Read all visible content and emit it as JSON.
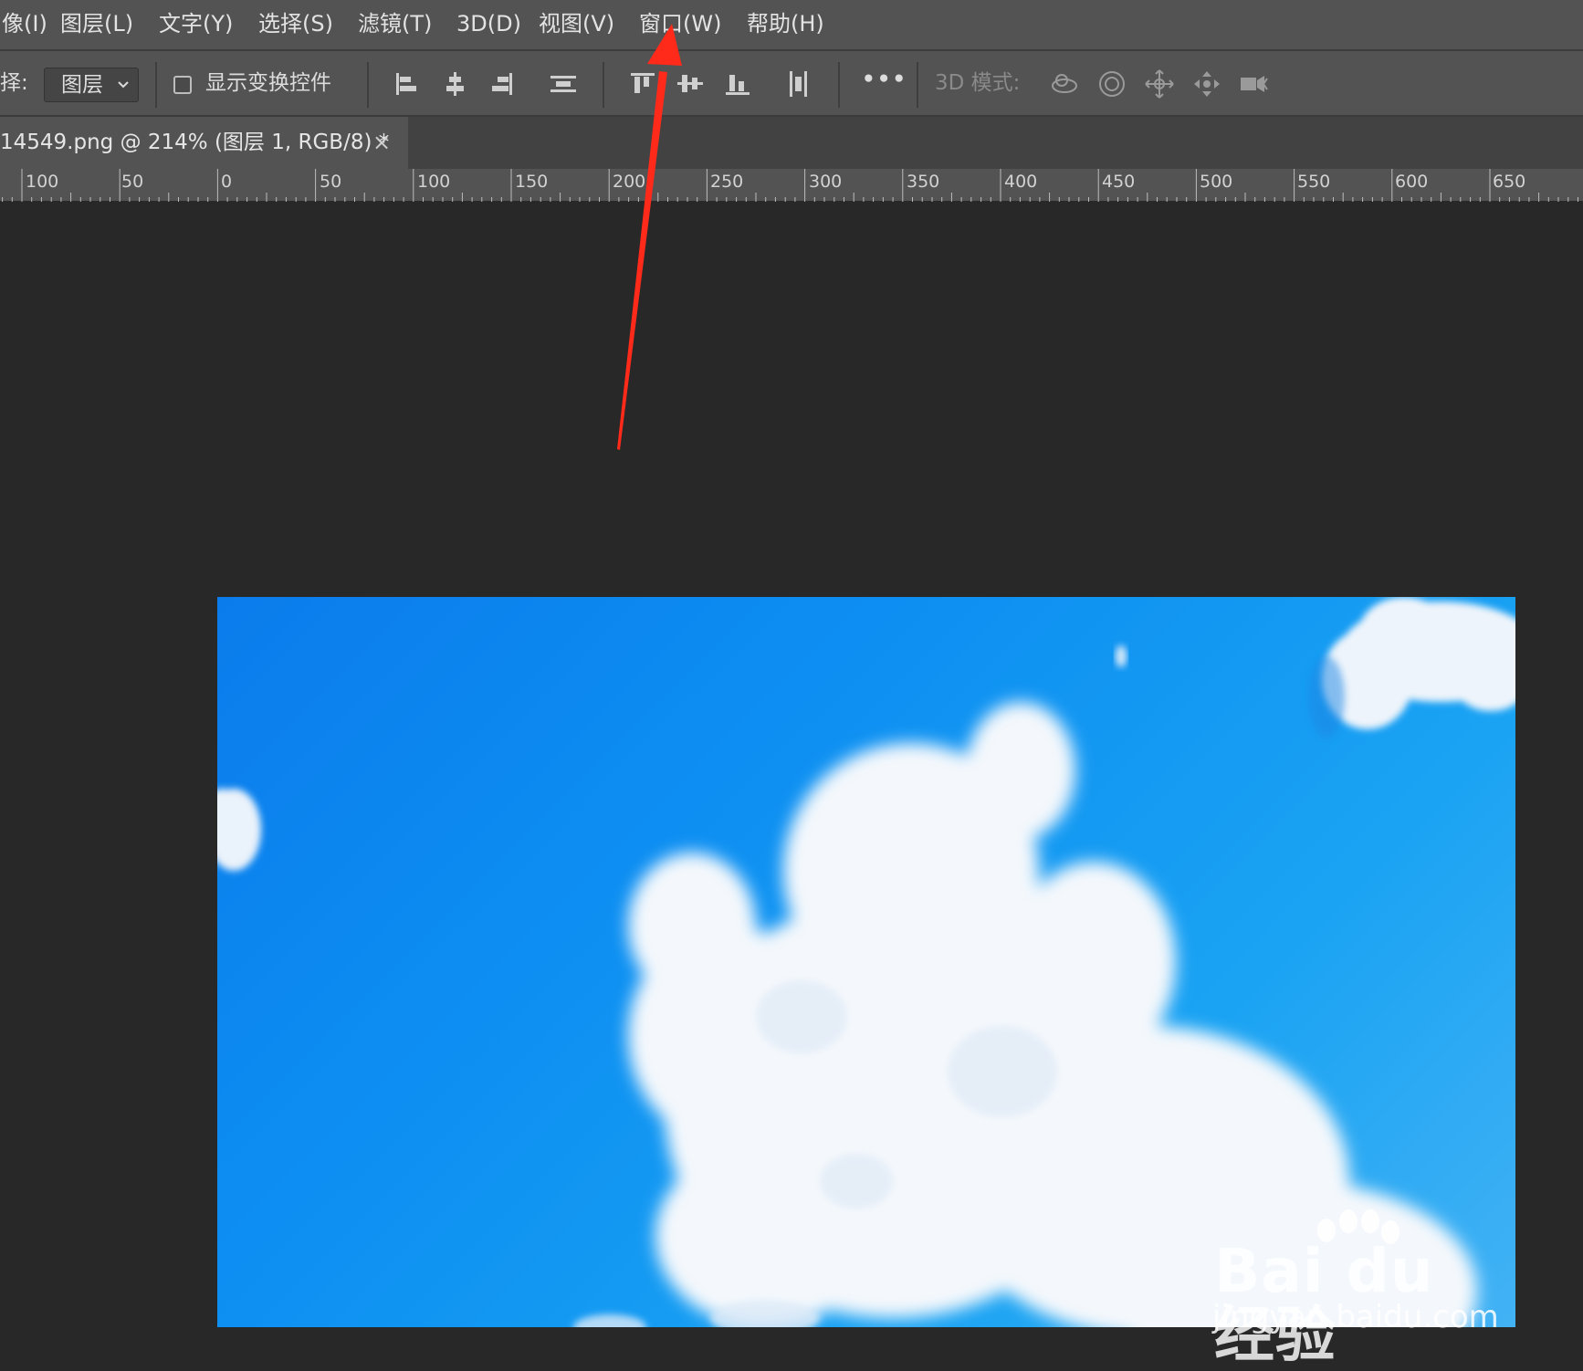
{
  "menubar": {
    "items": [
      {
        "label": "像(I)"
      },
      {
        "label": "图层(L)"
      },
      {
        "label": "文字(Y)"
      },
      {
        "label": "选择(S)"
      },
      {
        "label": "滤镜(T)"
      },
      {
        "label": "3D(D)"
      },
      {
        "label": "视图(V)"
      },
      {
        "label": "窗口(W)"
      },
      {
        "label": "帮助(H)"
      }
    ]
  },
  "optionsbar": {
    "select_prefix": "择:",
    "layer_select_value": "图层",
    "show_transform_label": "显示变换控件",
    "mode_3d_label": "3D 模式:",
    "more_label": "•••"
  },
  "document": {
    "tab_title": "14549.png @ 214% (图层 1, RGB/8) *",
    "close_glyph": "×"
  },
  "ruler": {
    "labels": [
      "100",
      "50",
      "0",
      "50",
      "100",
      "150",
      "200",
      "250",
      "300",
      "350",
      "400",
      "450",
      "500",
      "550",
      "600",
      "650"
    ]
  },
  "watermark": {
    "brand": "Bai du 经验",
    "url": "jingyan.baidu.com"
  },
  "colors": {
    "menubar": "#535353",
    "workspace": "#282828",
    "annotation": "#ff2a1a",
    "sky": "#0d8ff2"
  },
  "icons": {
    "align": [
      "align-left-icon",
      "align-hcenter-icon",
      "align-right-icon",
      "distribute-horizontal-icon",
      "align-top-icon",
      "align-vcenter-icon",
      "align-bottom-icon",
      "distribute-vertical-icon"
    ],
    "mode_3d": [
      "orbit-3d-icon",
      "roll-3d-icon",
      "pan-3d-icon",
      "slide-3d-icon",
      "scale-3d-icon"
    ]
  }
}
